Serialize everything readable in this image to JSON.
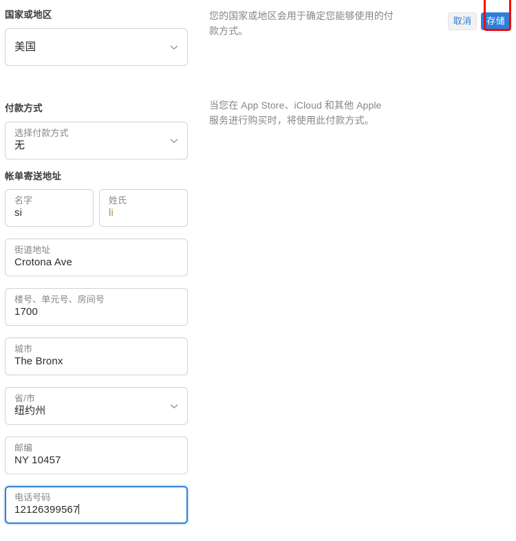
{
  "actions": {
    "cancel_label": "取消",
    "save_label": "存储",
    "highlight_color": "#ff0000",
    "save_bg": "#2f7fd8",
    "cancel_fg": "#2b7cd3"
  },
  "country_section": {
    "title": "国家或地区",
    "field": {
      "label": "",
      "value": "美国",
      "icon": "chevron-down-icon"
    },
    "help": "您的国家或地区会用于确定您能够使用的付款方式。"
  },
  "payment_section": {
    "title": "付款方式",
    "field": {
      "label": "选择付款方式",
      "value": "无",
      "icon": "chevron-down-icon"
    },
    "help": "当您在 App Store、iCloud 和其他 Apple 服务进行购买时，将使用此付款方式。"
  },
  "billing_section": {
    "title": "帐单寄送地址",
    "first_name": {
      "label": "名字",
      "value": "si"
    },
    "last_name": {
      "label": "姓氏",
      "value": "li"
    },
    "street": {
      "label": "街道地址",
      "value": "Crotona Ave"
    },
    "unit": {
      "label": "楼号、单元号、房间号",
      "value": "1700"
    },
    "city": {
      "label": "城市",
      "value": "The Bronx"
    },
    "state": {
      "label": "省/市",
      "value": "纽约州",
      "icon": "chevron-down-icon"
    },
    "postal": {
      "label": "邮编",
      "value": "NY 10457"
    },
    "phone": {
      "label": "电话号码",
      "value": "12126399567",
      "focused": true
    }
  }
}
